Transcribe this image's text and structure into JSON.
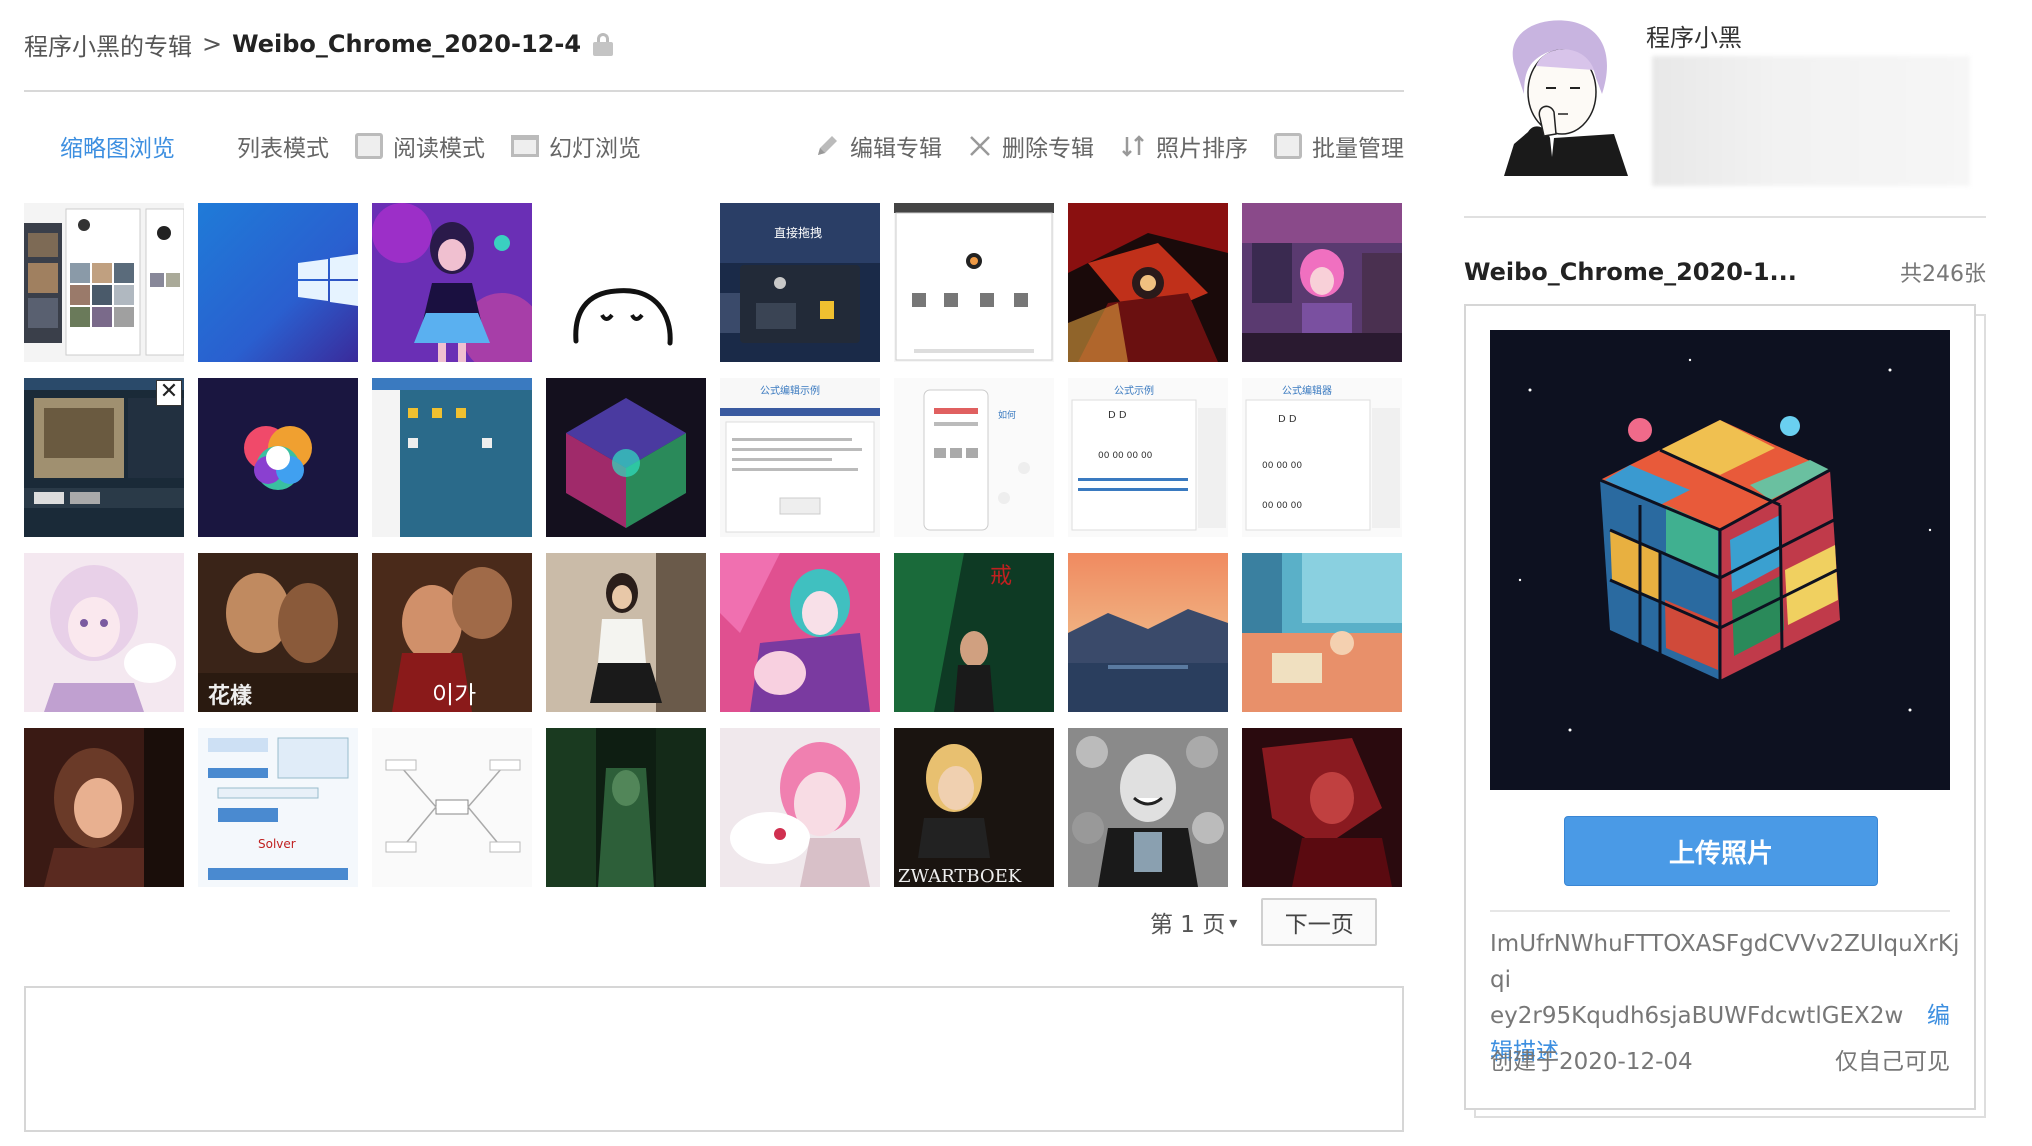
{
  "breadcrumb": {
    "owner_album": "程序小黑的专辑",
    "separator": ">",
    "album_name": "Weibo_Chrome_2020-12-4"
  },
  "toolbar": {
    "thumbnail_view": "缩略图浏览",
    "list_mode": "列表模式",
    "reading_mode": "阅读模式",
    "slideshow": "幻灯浏览",
    "edit_album": "编辑专辑",
    "delete_album": "删除专辑",
    "sort_photos": "照片排序",
    "batch_manage": "批量管理"
  },
  "pager": {
    "current_page": "第 1 页",
    "next_page": "下一页"
  },
  "profile": {
    "username": "程序小黑"
  },
  "album": {
    "title": "Weibo_Chrome_2020-1...",
    "count": "共246张",
    "upload_button": "上传照片",
    "description_part1": "ImUfrNWhuFTTOXASFgdCVVv2ZUIquXrKjqi",
    "description_part2": "ey2r95Kqudh6sjaBUWFdcwtlGEX2w",
    "edit_desc_1": "编",
    "edit_desc_2": "辑描述",
    "created": "创建于2020-12-04",
    "visibility": "仅自己可见"
  },
  "colors": {
    "accent": "#3d8fe0",
    "upload_button": "#4a9ae6"
  }
}
